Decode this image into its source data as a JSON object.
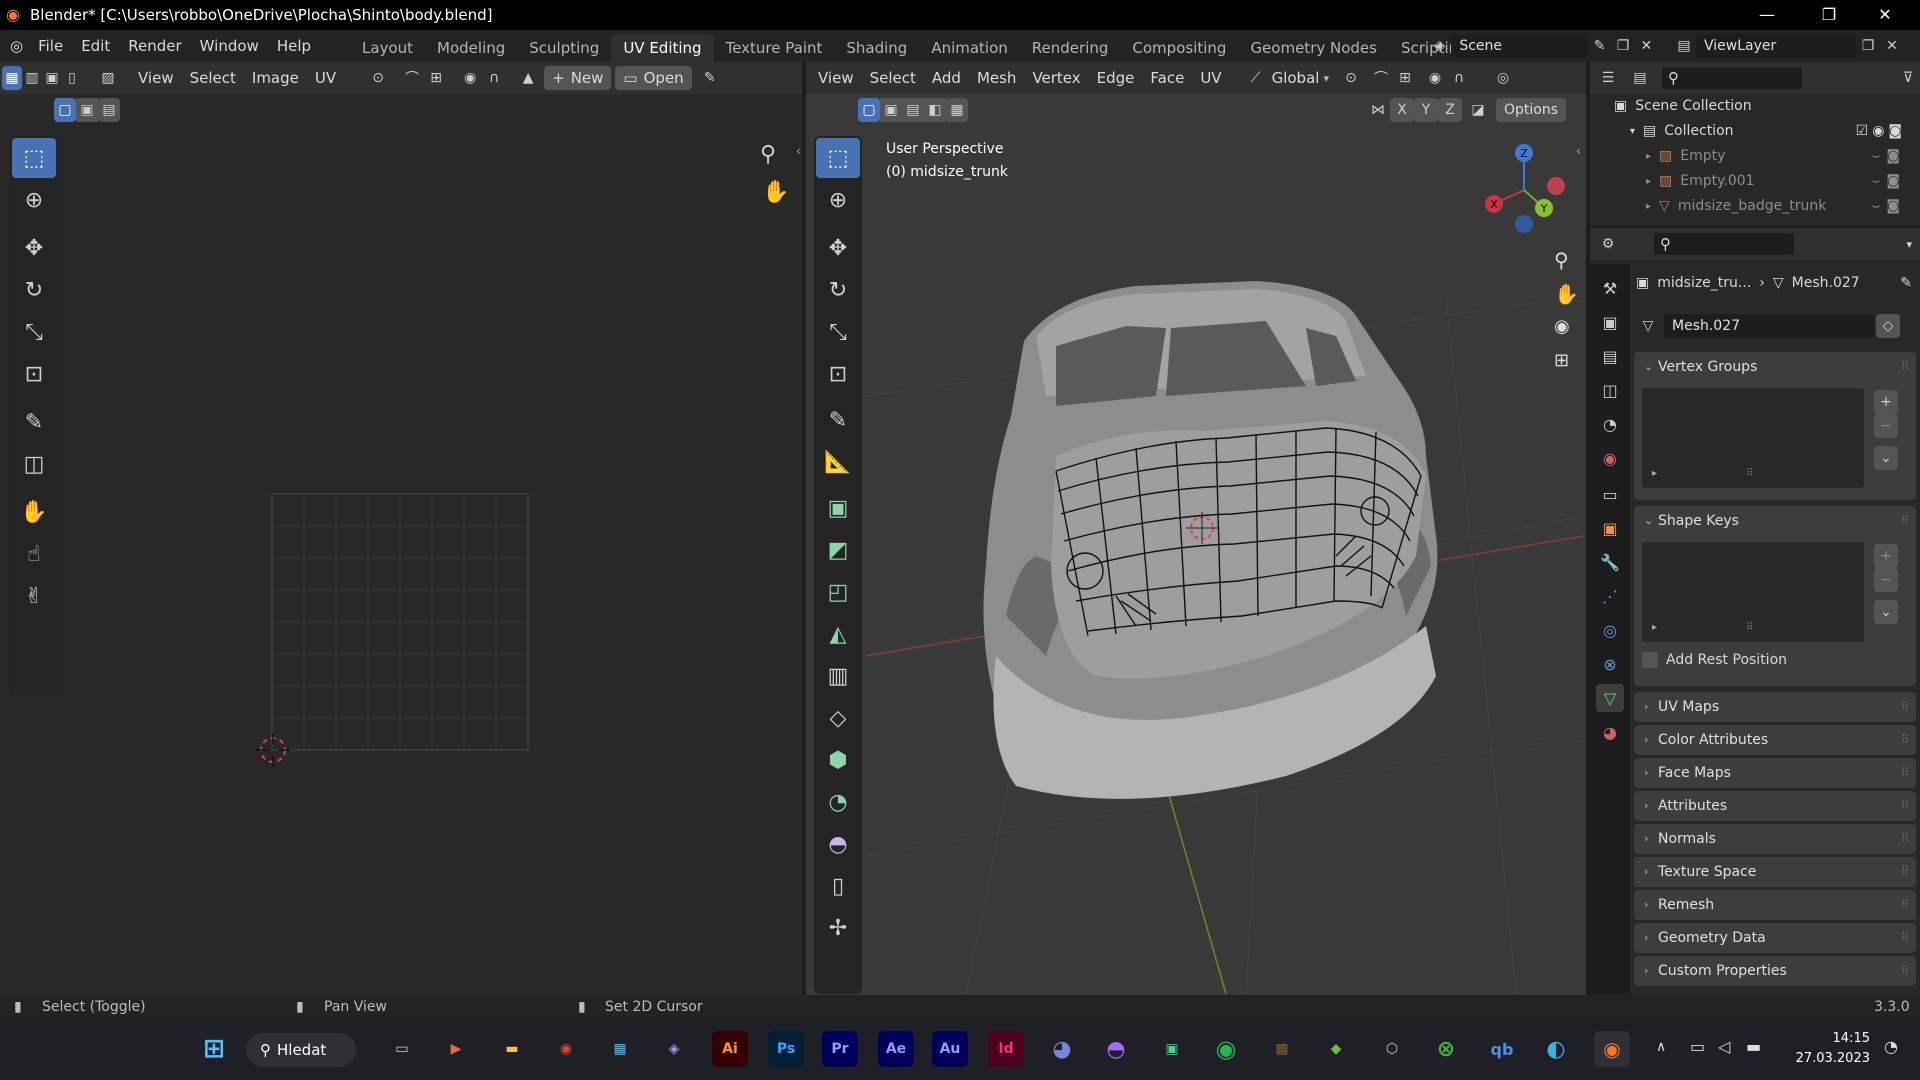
{
  "window": {
    "title": "Blender* [C:\\Users\\robbo\\OneDrive\\Plocha\\Shinto\\body.blend]",
    "minimize": "—",
    "maximize": "❐",
    "close": "✕"
  },
  "menu": [
    "File",
    "Edit",
    "Render",
    "Window",
    "Help"
  ],
  "workspaces": [
    "Layout",
    "Modeling",
    "Sculpting",
    "UV Editing",
    "Texture Paint",
    "Shading",
    "Animation",
    "Rendering",
    "Compositing",
    "Geometry Nodes",
    "Scripting"
  ],
  "workspace_active": "UV Editing",
  "workspace_add": "+",
  "scene": {
    "label": "Scene",
    "view_layer": "ViewLayer"
  },
  "uv_editor": {
    "menu": [
      "View",
      "Select",
      "Image",
      "UV"
    ],
    "new_label": "New",
    "open_label": "Open"
  },
  "viewport": {
    "menu": [
      "View",
      "Select",
      "Add",
      "Mesh",
      "Vertex",
      "Edge",
      "Face",
      "UV"
    ],
    "transform_orientation": "Global",
    "options_label": "Options",
    "axis_x": "X",
    "axis_y": "Y",
    "axis_z": "Z",
    "info_line1": "User Perspective",
    "info_line2": "(0) midsize_trunk",
    "gizmo": {
      "x": "X",
      "y": "Y",
      "z": "Z"
    }
  },
  "outliner": {
    "scene_collection": "Scene Collection",
    "collection": "Collection",
    "items": [
      "Empty",
      "Empty.001",
      "midsize_badge_trunk"
    ]
  },
  "properties": {
    "object_name": "midsize_tru...",
    "mesh_name": "Mesh.027",
    "mesh_field": "Mesh.027",
    "panels_top": [
      "Vertex Groups",
      "Shape Keys"
    ],
    "add_rest_position": "Add Rest Position",
    "panels_collapsed": [
      "UV Maps",
      "Color Attributes",
      "Face Maps",
      "Attributes",
      "Normals",
      "Texture Space",
      "Remesh",
      "Geometry Data",
      "Custom Properties"
    ]
  },
  "status": {
    "select": "Select (Toggle)",
    "pan": "Pan View",
    "cursor": "Set 2D Cursor",
    "version": "3.3.0"
  },
  "taskbar": {
    "search": "Hledat",
    "apps": [
      "Ai",
      "Ps",
      "Pr",
      "Ae",
      "Au",
      "Id"
    ],
    "time": "14:15",
    "date": "27.03.2023"
  }
}
